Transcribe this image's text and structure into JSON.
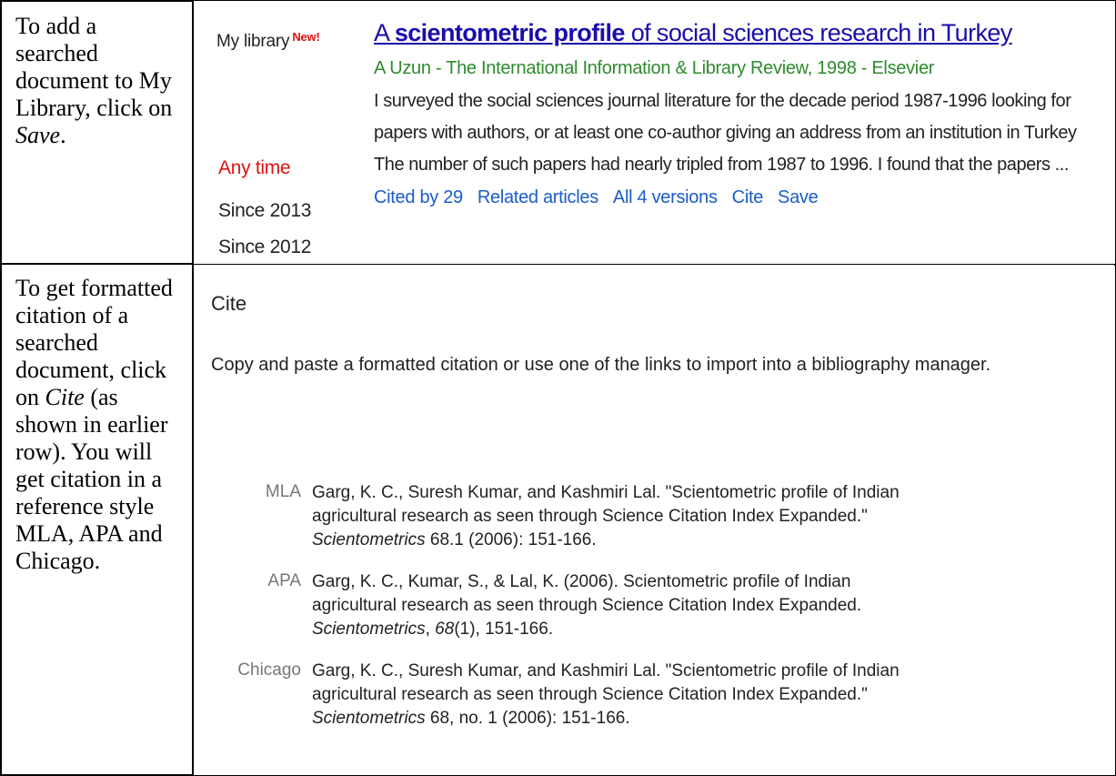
{
  "row1": {
    "instruction_before": "To add a searched document to My Library, click on ",
    "instruction_em": "Save",
    "instruction_after": ".",
    "sidebar": {
      "my_library": "My library",
      "new_badge": "New!",
      "time_filters": [
        "Any time",
        "Since 2013",
        "Since 2012"
      ],
      "active_color": "#dd1111"
    },
    "result": {
      "title_prefix": "A ",
      "title_bold": "scientometric profile",
      "title_suffix": " of social sciences research in Turkey",
      "meta": "A Uzun - The International Information & Library Review, 1998 - Elsevier",
      "snippet": [
        "I surveyed the social sciences journal literature for the decade period 1987-1996 looking for",
        "papers with authors, or at least one co-author giving an address from an institution in Turkey",
        "The number of such papers had nearly tripled from 1987 to 1996. I found that the papers ..."
      ],
      "links": [
        "Cited by 29",
        "Related articles",
        "All 4 versions",
        "Cite",
        "Save"
      ],
      "link_color": "#1a5ccc",
      "title_color": "#1a0dab",
      "meta_color": "#2e8b2e"
    }
  },
  "row2": {
    "instruction_p1": "To get formatted citation of a searched document, click on ",
    "instruction_em": "Cite",
    "instruction_p2": " (as shown in earlier row). You will get citation in a reference style MLA, APA and Chicago.",
    "dialog": {
      "heading": "Cite",
      "intro": "Copy and paste a formatted citation or use one of the links to import into a bibliography manager.",
      "citations": [
        {
          "style": "MLA",
          "lines": [
            "Garg, K. C., Suresh Kumar, and Kashmiri Lal. \"Scientometric profile of Indian",
            "agricultural research as seen through Science Citation Index Expanded.\""
          ],
          "journal": "Scientometrics",
          "volume_em": "",
          "tail": " 68.1 (2006): 151-166."
        },
        {
          "style": "APA",
          "lines": [
            "Garg, K. C., Kumar, S., & Lal, K. (2006). Scientometric profile of Indian",
            "agricultural research as seen through Science Citation Index Expanded."
          ],
          "journal": "Scientometrics",
          "volume_em": "68",
          "tail": "(1), 151-166."
        },
        {
          "style": "Chicago",
          "lines": [
            "Garg, K. C., Suresh Kumar, and Kashmiri Lal. \"Scientometric profile of Indian",
            "agricultural research as seen through Science Citation Index Expanded.\""
          ],
          "journal": "Scientometrics",
          "volume_em": "",
          "tail": " 68, no. 1 (2006): 151-166."
        }
      ]
    }
  }
}
